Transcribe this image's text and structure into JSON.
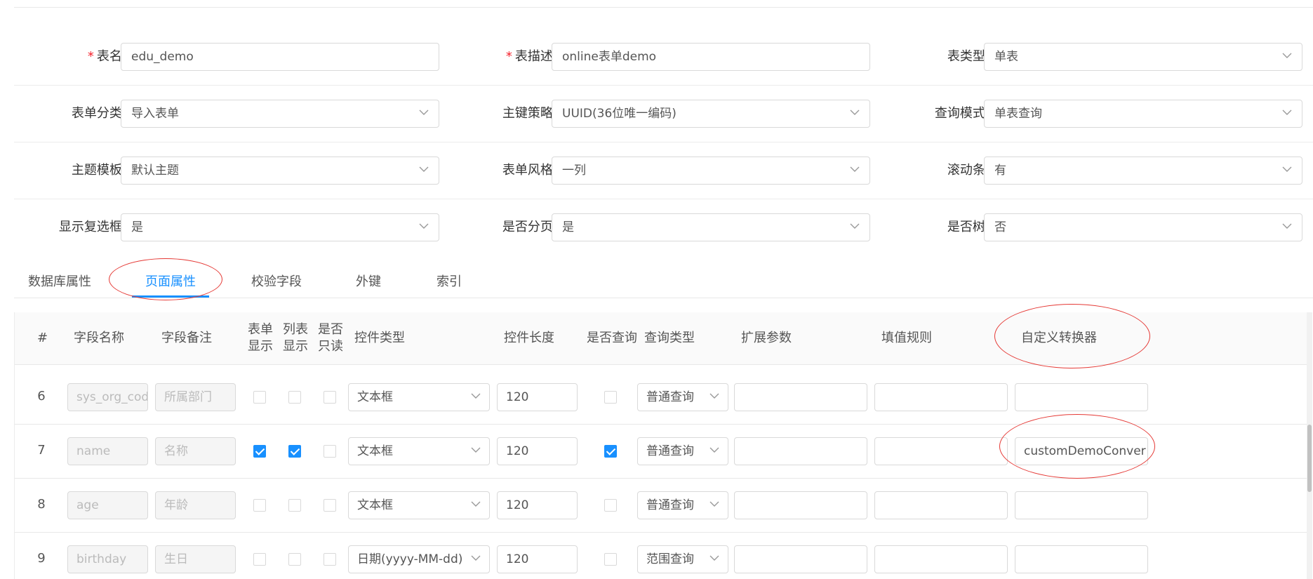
{
  "form": {
    "rows": [
      [
        {
          "label": "表名",
          "value": "edu_demo",
          "required": true,
          "type": "input"
        },
        {
          "label": "表描述",
          "value": "online表单demo",
          "required": true,
          "type": "input"
        },
        {
          "label": "表类型",
          "value": "单表",
          "required": false,
          "type": "select"
        }
      ],
      [
        {
          "label": "表单分类",
          "value": "导入表单",
          "required": false,
          "type": "select"
        },
        {
          "label": "主键策略",
          "value": "UUID(36位唯一编码)",
          "required": false,
          "type": "select"
        },
        {
          "label": "查询模式",
          "value": "单表查询",
          "required": false,
          "type": "select"
        }
      ],
      [
        {
          "label": "主题模板",
          "value": "默认主题",
          "required": false,
          "type": "select"
        },
        {
          "label": "表单风格",
          "value": "一列",
          "required": false,
          "type": "select"
        },
        {
          "label": "滚动条",
          "value": "有",
          "required": false,
          "type": "select"
        }
      ],
      [
        {
          "label": "显示复选框",
          "value": "是",
          "required": false,
          "type": "select"
        },
        {
          "label": "是否分页",
          "value": "是",
          "required": false,
          "type": "select"
        },
        {
          "label": "是否树",
          "value": "否",
          "required": false,
          "type": "select"
        }
      ]
    ]
  },
  "tabs": [
    "数据库属性",
    "页面属性",
    "校验字段",
    "外键",
    "索引"
  ],
  "active_tab": 1,
  "table": {
    "headers": {
      "index": "#",
      "field_name": "字段名称",
      "field_remark": "字段备注",
      "form_show": [
        "表单",
        "显示"
      ],
      "list_show": [
        "列表",
        "显示"
      ],
      "readonly": [
        "是否",
        "只读"
      ],
      "control_type": "控件类型",
      "control_length": "控件长度",
      "is_query": "是否查询",
      "query_type": "查询类型",
      "ext_params": "扩展参数",
      "fill_rule": "填值规则",
      "converter": "自定义转换器"
    },
    "rows": [
      {
        "index": "6",
        "field_name": "sys_org_code",
        "field_remark": "所属部门",
        "form_show": false,
        "list_show": false,
        "readonly": false,
        "control_type": "文本框",
        "control_length": "120",
        "is_query": false,
        "query_type": "普通查询",
        "ext_params": "",
        "fill_rule": "",
        "converter": ""
      },
      {
        "index": "7",
        "field_name": "name",
        "field_remark": "名称",
        "form_show": true,
        "list_show": true,
        "readonly": false,
        "control_type": "文本框",
        "control_length": "120",
        "is_query": true,
        "query_type": "普通查询",
        "ext_params": "",
        "fill_rule": "",
        "converter": "customDemoConver"
      },
      {
        "index": "8",
        "field_name": "age",
        "field_remark": "年龄",
        "form_show": false,
        "list_show": false,
        "readonly": false,
        "control_type": "文本框",
        "control_length": "120",
        "is_query": false,
        "query_type": "普通查询",
        "ext_params": "",
        "fill_rule": "",
        "converter": ""
      },
      {
        "index": "9",
        "field_name": "birthday",
        "field_remark": "生日",
        "form_show": false,
        "list_show": false,
        "readonly": false,
        "control_type": "日期(yyyy-MM-dd)",
        "control_length": "120",
        "is_query": false,
        "query_type": "范围查询",
        "ext_params": "",
        "fill_rule": "",
        "converter": ""
      }
    ]
  },
  "icons": {
    "chevron": "chevron-down-icon",
    "check": "checkbox-check-icon"
  },
  "colors": {
    "accent": "#1890ff",
    "required": "#f5222d",
    "annotation": "#e53935",
    "border": "#d9d9d9"
  }
}
